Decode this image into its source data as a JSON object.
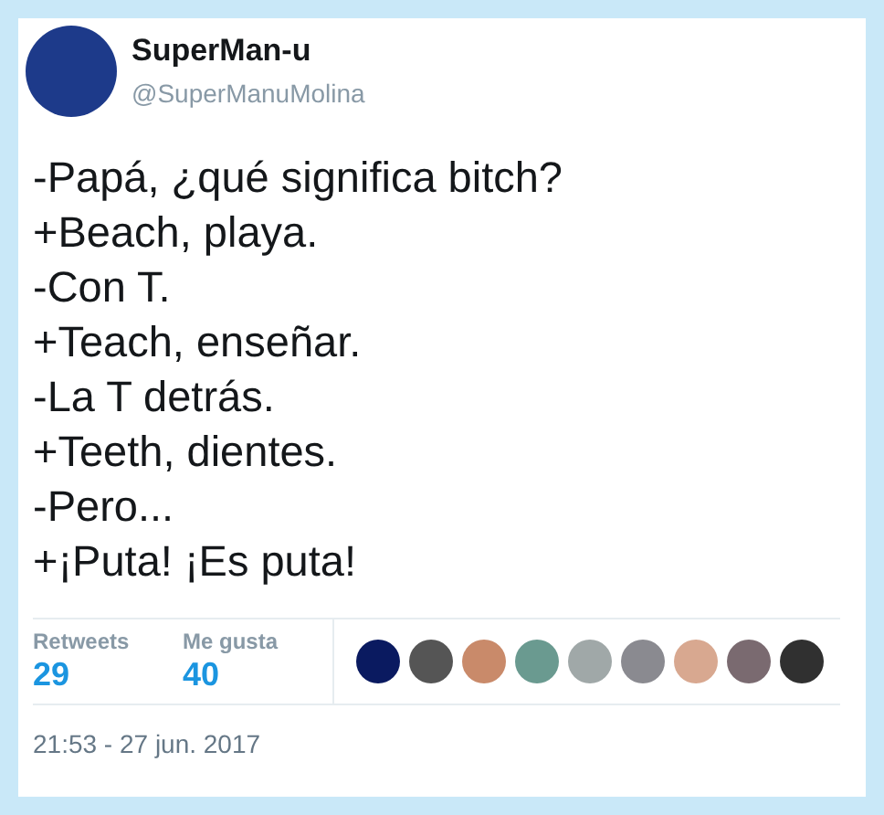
{
  "author": {
    "name": "SuperMan-u",
    "handle": "@SuperManuMolina"
  },
  "tweet_lines": [
    "-Papá, ¿qué significa bitch?",
    "+Beach, playa.",
    "-Con T.",
    "+Teach, enseñar.",
    "-La T detrás.",
    "+Teeth, dientes.",
    "-Pero...",
    "+¡Puta! ¡Es puta!"
  ],
  "stats": [
    {
      "label": "Retweets",
      "value": "29"
    },
    {
      "label": "Me gusta",
      "value": "40"
    }
  ],
  "liker_avatars": [
    {
      "kind": "avatar"
    },
    {
      "kind": "avatar"
    },
    {
      "kind": "avatar"
    },
    {
      "kind": "avatar"
    },
    {
      "kind": "avatar"
    },
    {
      "kind": "avatar"
    },
    {
      "kind": "avatar"
    },
    {
      "kind": "avatar"
    },
    {
      "kind": "avatar"
    }
  ],
  "timestamp": "21:53 - 27 jun. 2017"
}
